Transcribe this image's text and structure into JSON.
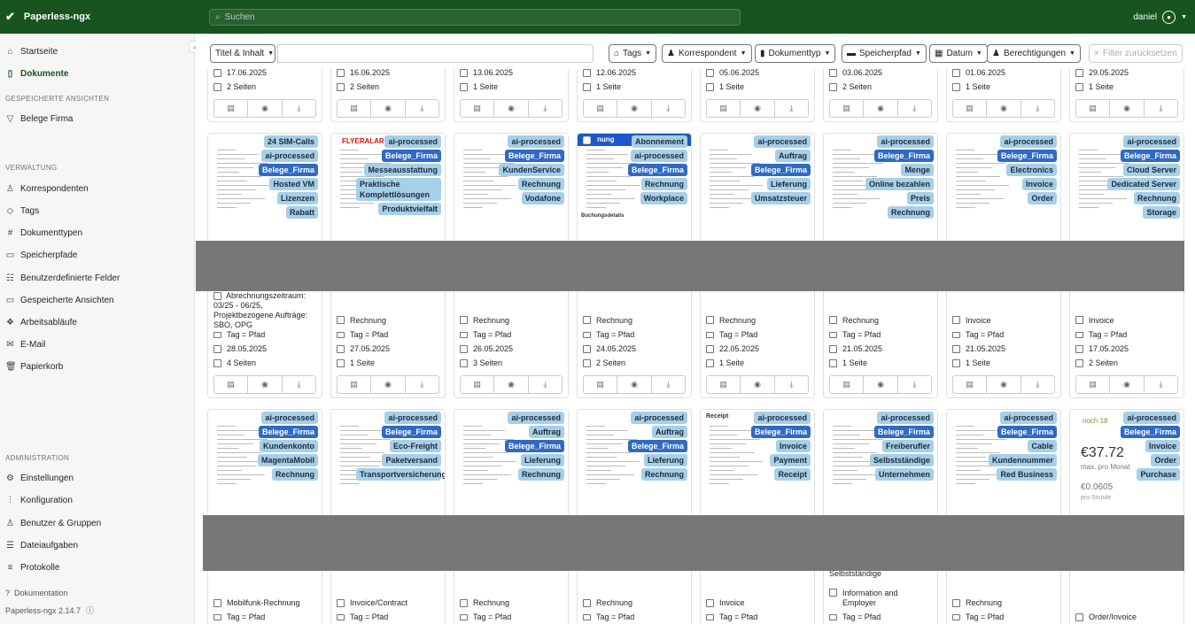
{
  "app": {
    "title": "Paperless-ngx",
    "search_placeholder": "Suchen",
    "user": "daniel"
  },
  "sidebar": {
    "main": [
      {
        "label": "Startseite",
        "icon": "house-icon"
      },
      {
        "label": "Dokumente",
        "icon": "document-icon",
        "active": true
      }
    ],
    "saved_views_header": "GESPEICHERTE ANSICHTEN",
    "saved_views": [
      {
        "label": "Belege Firma",
        "icon": "funnel-icon"
      }
    ],
    "manage_header": "VERWALTUNG",
    "manage": [
      {
        "label": "Korrespondenten",
        "icon": "person-icon"
      },
      {
        "label": "Tags",
        "icon": "tag-icon"
      },
      {
        "label": "Dokumenttypen",
        "icon": "hash-icon"
      },
      {
        "label": "Speicherpfade",
        "icon": "folder-icon"
      },
      {
        "label": "Benutzerdefinierte Felder",
        "icon": "ui-checks-icon"
      },
      {
        "label": "Gespeicherte Ansichten",
        "icon": "window-icon"
      },
      {
        "label": "Arbeitsabläufe",
        "icon": "boxes-icon"
      },
      {
        "label": "E-Mail",
        "icon": "envelope-icon"
      },
      {
        "label": "Papierkorb",
        "icon": "trash-icon"
      }
    ],
    "admin_header": "ADMINISTRATION",
    "admin": [
      {
        "label": "Einstellungen",
        "icon": "gear-icon"
      },
      {
        "label": "Konfiguration",
        "icon": "sliders-icon"
      },
      {
        "label": "Benutzer & Gruppen",
        "icon": "people-icon"
      },
      {
        "label": "Dateiaufgaben",
        "icon": "list-task-icon"
      },
      {
        "label": "Protokolle",
        "icon": "text-list-icon"
      }
    ],
    "docs_link": "Dokumentation",
    "version": "Paperless-ngx 2.14.7"
  },
  "filters": {
    "title_content": "Titel & Inhalt",
    "tags": "Tags",
    "correspondent": "Korrespondent",
    "doctype": "Dokumenttyp",
    "storage_path": "Speicherpfad",
    "date": "Datum",
    "permissions": "Berechtigungen",
    "reset": "Filter zurücksetzen"
  },
  "row0": [
    {
      "date": "17.06.2025",
      "pages": "2 Seiten"
    },
    {
      "date": "16.06.2025",
      "pages": "2 Seiten"
    },
    {
      "date": "13.06.2025",
      "pages": "1 Seite"
    },
    {
      "date": "12.06.2025",
      "pages": "1 Seite"
    },
    {
      "date": "05.06.2025",
      "pages": "1 Seite"
    },
    {
      "date": "03.06.2025",
      "pages": "2 Seiten"
    },
    {
      "date": "01.06.2025",
      "pages": "1 Seite"
    },
    {
      "date": "29.05.2025",
      "pages": "1 Seite"
    }
  ],
  "row1": [
    {
      "tags": [
        "24 SIM-Calls",
        "ai-processed",
        "Belege_Firma",
        "Hosted VM",
        "Lizenzen",
        "Rabatt"
      ],
      "title": "Abrechnungszeitraum: 03/25 - 06/25, Projektbezogene Aufträge: SBO, OPG",
      "path": "Tag = Pfad",
      "date": "28.05.2025",
      "pages": "4 Seiten",
      "logo": ""
    },
    {
      "tags": [
        "ai-processed",
        "Belege_Firma",
        "Messeausstattung",
        "Praktische Komplettlösungen",
        "Produktvielfalt"
      ],
      "title": "Rechnung",
      "path": "Tag = Pfad",
      "date": "27.05.2025",
      "pages": "1 Seite",
      "logo": "FLYERALARM"
    },
    {
      "tags": [
        "ai-processed",
        "Belege_Firma",
        "KundenService",
        "Rechnung",
        "Vodafone"
      ],
      "title": "Rechnung",
      "path": "Tag = Pfad",
      "date": "26.05.2025",
      "pages": "3 Seiten",
      "logo": ""
    },
    {
      "tags": [
        "Abonnement",
        "ai-processed",
        "Belege_Firma",
        "Rechnung",
        "Workplace"
      ],
      "title": "Rechnung",
      "path": "Tag = Pfad",
      "date": "24.05.2025",
      "pages": "2 Seiten",
      "logo": "",
      "header": "nung",
      "subhead": "Buchungsdetails"
    },
    {
      "tags": [
        "ai-processed",
        "Auftrag",
        "Belege_Firma",
        "Lieferung",
        "Umsatzsteuer"
      ],
      "title": "Rechnung",
      "path": "Tag = Pfad",
      "date": "22.05.2025",
      "pages": "1 Seite",
      "logo": ""
    },
    {
      "tags": [
        "ai-processed",
        "Belege_Firma",
        "Menge",
        "Online bezahlen",
        "Preis",
        "Rechnung"
      ],
      "title": "Rechnung",
      "path": "Tag = Pfad",
      "date": "21.05.2025",
      "pages": "1 Seite",
      "logo": ""
    },
    {
      "tags": [
        "ai-processed",
        "Belege_Firma",
        "Electronics",
        "Invoice",
        "Order"
      ],
      "title": "Invoice",
      "path": "Tag = Pfad",
      "date": "21.05.2025",
      "pages": "1 Seite",
      "logo": ""
    },
    {
      "tags": [
        "ai-processed",
        "Belege_Firma",
        "Cloud Server",
        "Dedicated Server",
        "Rechnung",
        "Storage"
      ],
      "title": "Invoice",
      "path": "Tag = Pfad",
      "date": "17.05.2025",
      "pages": "2 Seiten",
      "logo": ""
    }
  ],
  "row2": [
    {
      "tags": [
        "ai-processed",
        "Belege_Firma",
        "Kundenkonto",
        "MagentaMobil",
        "Rechnung"
      ],
      "title": "Mobilfunk-Rechnung",
      "path": "Tag = Pfad"
    },
    {
      "tags": [
        "ai-processed",
        "Belege_Firma",
        "Eco-Freight",
        "Paketversand",
        "Transportversicherung"
      ],
      "title": "Invoice/Contract",
      "path": "Tag = Pfad"
    },
    {
      "tags": [
        "ai-processed",
        "Auftrag",
        "Belege_Firma",
        "Lieferung",
        "Rechnung"
      ],
      "title": "Rechnung",
      "path": "Tag = Pfad"
    },
    {
      "tags": [
        "ai-processed",
        "Auftrag",
        "Belege_Firma",
        "Lieferung",
        "Rechnung"
      ],
      "title": "Rechnung",
      "path": "Tag = Pfad"
    },
    {
      "tags": [
        "ai-processed",
        "Belege_Firma",
        "Invoice",
        "Payment",
        "Receipt"
      ],
      "title": "Invoice",
      "path": "Tag = Pfad",
      "logo": "Receipt"
    },
    {
      "tags": [
        "ai-processed",
        "Belege_Firma",
        "Freiberufler",
        "Selbstständige",
        "Unternehmen"
      ],
      "title": "Information and Employer",
      "title_pre": "Selbstständige",
      "path": "Tag = Pfad"
    },
    {
      "tags": [
        "ai-processed",
        "Belege_Firma",
        "Cable",
        "Kundennummer",
        "Red Business"
      ],
      "title": "Rechnung",
      "path": "Tag = Pfad"
    },
    {
      "tags": [
        "ai-processed",
        "Belege_Firma",
        "Invoice",
        "Order",
        "Purchase"
      ],
      "title": "Order/Invoice",
      "path": "",
      "promo": "noch 18",
      "price": "€37.72",
      "price_sub": "max. pro Monat",
      "price2": "€0.0605",
      "price2_sub": "pro Stunde"
    }
  ],
  "blue_tags": [
    "Belege_Firma"
  ],
  "colors": {
    "topbar": "#17541f",
    "tag": "#a6cfe8",
    "tag_primary": "#2e6ac6"
  }
}
